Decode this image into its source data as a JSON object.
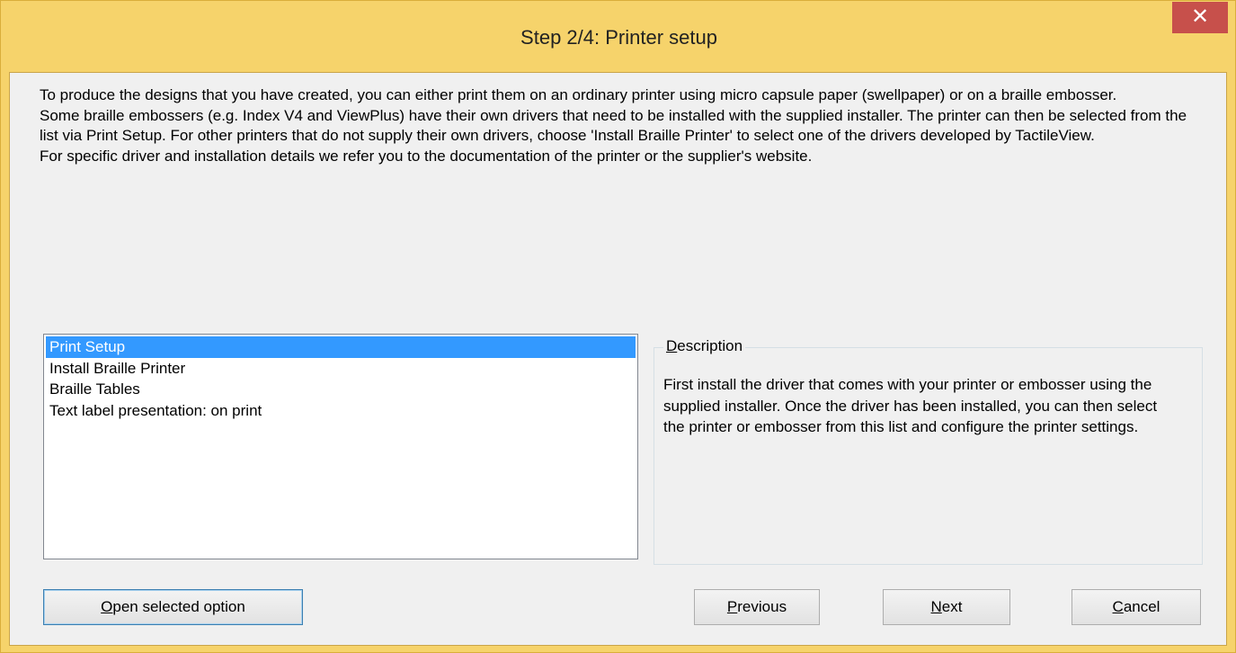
{
  "window": {
    "title": "Step 2/4: Printer setup",
    "close_glyph": "✕"
  },
  "intro": {
    "paragraphs": [
      "To produce the designs that you have created, you can either print them on an ordinary printer using micro capsule paper (swellpaper) or on a braille embosser.",
      "Some braille embossers (e.g. Index V4 and ViewPlus) have their own drivers that need to be installed with the supplied installer. The printer can then be selected from the list via Print Setup. For other printers that do not supply their own drivers, choose 'Install Braille Printer' to select one of the drivers developed by TactileView.",
      "For specific driver and installation details we refer you to the documentation of the printer or the supplier's website."
    ]
  },
  "options_list": {
    "items": [
      "Print Setup",
      "Install Braille Printer",
      "Braille Tables",
      "Text label presentation: on print"
    ],
    "selected": "Print Setup"
  },
  "description": {
    "legend_accel": "D",
    "legend_rest": "escription",
    "text": "First install the driver that comes with your printer or embosser using the supplied installer. Once the driver has been installed, you can then select the printer or embosser from this list and configure the printer settings."
  },
  "buttons": {
    "open_accel": "O",
    "open_rest": "pen selected option",
    "previous_accel": "P",
    "previous_rest": "revious",
    "next_accel": "N",
    "next_rest": "ext",
    "cancel_accel": "C",
    "cancel_rest": "ancel"
  },
  "colors": {
    "frame": "#f6d36b",
    "close_button": "#c7504b",
    "selection": "#3399ff",
    "client_bg": "#f0f0f0"
  }
}
